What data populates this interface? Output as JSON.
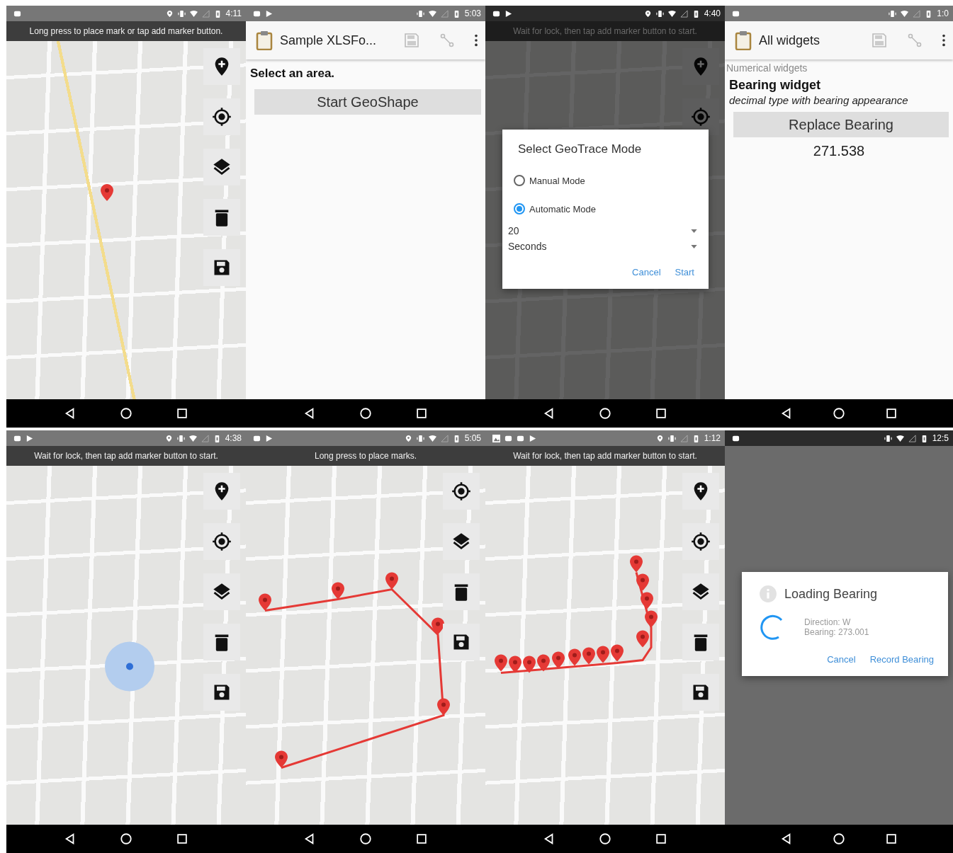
{
  "screens": [
    {
      "kind": "map",
      "dimmed": false,
      "status_bar": {
        "left_icons": [
          {
            "kind": "notification"
          }
        ],
        "right_icons": [
          {
            "kind": "location"
          },
          {
            "kind": "vibrate"
          },
          {
            "kind": "wifi"
          },
          {
            "kind": "signal"
          },
          {
            "kind": "battery"
          }
        ],
        "time": "4:11"
      },
      "banner": "Long press to place mark or tap add marker button.",
      "overlay": {
        "kind": "single_marker"
      },
      "map_buttons": [
        {
          "kind": "add_marker"
        },
        {
          "kind": "location"
        },
        {
          "kind": "layers"
        },
        {
          "kind": "delete"
        },
        {
          "kind": "save"
        }
      ]
    },
    {
      "kind": "form",
      "dimmed": false,
      "status_bar": {
        "left_icons": [
          {
            "kind": "notification"
          },
          {
            "kind": "play"
          }
        ],
        "right_icons": [
          {
            "kind": "vibrate"
          },
          {
            "kind": "wifi"
          },
          {
            "kind": "signal"
          },
          {
            "kind": "battery"
          }
        ],
        "time": "5:03"
      },
      "toolbar": {
        "title": "Sample XLSFo..."
      },
      "items": [
        {
          "kind": "question",
          "text": "Select an area."
        },
        {
          "kind": "button",
          "text": "Start GeoShape"
        }
      ]
    },
    {
      "kind": "map",
      "dimmed": true,
      "status_bar": {
        "left_icons": [
          {
            "kind": "notification"
          },
          {
            "kind": "play"
          }
        ],
        "right_icons": [
          {
            "kind": "location"
          },
          {
            "kind": "vibrate"
          },
          {
            "kind": "wifi"
          },
          {
            "kind": "signal"
          },
          {
            "kind": "battery"
          }
        ],
        "time": "4:40"
      },
      "banner": "Wait for lock, then tap add marker button to start.",
      "overlay": {
        "kind": "none"
      },
      "map_buttons": [
        {
          "kind": "add_marker"
        },
        {
          "kind": "location"
        }
      ],
      "dialog": {
        "kind": "choice",
        "title": "Select GeoTrace Mode",
        "options": [
          {
            "label": "Manual Mode",
            "selected": false
          },
          {
            "label": "Automatic Mode",
            "selected": true
          }
        ],
        "dropdowns": [
          "20",
          "Seconds"
        ],
        "actions": [
          "Cancel",
          "Start"
        ]
      }
    },
    {
      "kind": "form",
      "dimmed": false,
      "status_bar": {
        "left_icons": [
          {
            "kind": "notification"
          }
        ],
        "right_icons": [
          {
            "kind": "vibrate"
          },
          {
            "kind": "wifi"
          },
          {
            "kind": "signal"
          },
          {
            "kind": "battery"
          }
        ],
        "time": "1:0"
      },
      "toolbar": {
        "title": "All widgets"
      },
      "items": [
        {
          "kind": "group",
          "text": "Numerical widgets"
        },
        {
          "kind": "label",
          "text": "Bearing widget"
        },
        {
          "kind": "hint",
          "text": "decimal type with bearing appearance"
        },
        {
          "kind": "button",
          "text": "Replace Bearing"
        },
        {
          "kind": "value",
          "text": "271.538"
        }
      ]
    },
    {
      "kind": "map",
      "dimmed": false,
      "status_bar": {
        "left_icons": [
          {
            "kind": "notification"
          },
          {
            "kind": "play"
          }
        ],
        "right_icons": [
          {
            "kind": "location"
          },
          {
            "kind": "vibrate"
          },
          {
            "kind": "wifi"
          },
          {
            "kind": "signal"
          },
          {
            "kind": "battery"
          }
        ],
        "time": "4:38"
      },
      "banner": "Wait for lock, then tap add marker button to start.",
      "overlay": {
        "kind": "location_dot"
      },
      "map_buttons": [
        {
          "kind": "add_marker"
        },
        {
          "kind": "location"
        },
        {
          "kind": "layers"
        },
        {
          "kind": "delete"
        },
        {
          "kind": "save"
        }
      ]
    },
    {
      "kind": "map",
      "dimmed": false,
      "status_bar": {
        "left_icons": [
          {
            "kind": "notification"
          },
          {
            "kind": "play"
          }
        ],
        "right_icons": [
          {
            "kind": "location"
          },
          {
            "kind": "vibrate"
          },
          {
            "kind": "wifi"
          },
          {
            "kind": "signal"
          },
          {
            "kind": "battery"
          }
        ],
        "time": "5:05"
      },
      "banner": "Long press to place marks.",
      "overlay": {
        "kind": "polygon"
      },
      "map_buttons": [
        {
          "kind": "location"
        },
        {
          "kind": "layers"
        },
        {
          "kind": "delete"
        },
        {
          "kind": "save"
        }
      ]
    },
    {
      "kind": "map",
      "dimmed": false,
      "status_bar": {
        "left_icons": [
          {
            "kind": "image"
          },
          {
            "kind": "notification"
          },
          {
            "kind": "notification"
          },
          {
            "kind": "play"
          }
        ],
        "right_icons": [
          {
            "kind": "location"
          },
          {
            "kind": "vibrate"
          },
          {
            "kind": "signal"
          },
          {
            "kind": "battery"
          }
        ],
        "time": "1:12"
      },
      "banner": "Wait for lock, then tap add marker button to start.",
      "overlay": {
        "kind": "trace"
      },
      "map_buttons": [
        {
          "kind": "add_marker"
        },
        {
          "kind": "location"
        },
        {
          "kind": "layers"
        },
        {
          "kind": "delete"
        },
        {
          "kind": "save"
        }
      ]
    },
    {
      "kind": "blank",
      "dimmed": true,
      "status_bar": {
        "left_icons": [
          {
            "kind": "notification"
          }
        ],
        "right_icons": [
          {
            "kind": "vibrate"
          },
          {
            "kind": "wifi"
          },
          {
            "kind": "signal"
          },
          {
            "kind": "battery"
          }
        ],
        "time": "12:5"
      },
      "dialog": {
        "kind": "progress",
        "title": "Loading Bearing",
        "lines": [
          "Direction: W",
          "Bearing: 273.001"
        ],
        "actions": [
          "Cancel",
          "Record Bearing"
        ]
      }
    }
  ]
}
